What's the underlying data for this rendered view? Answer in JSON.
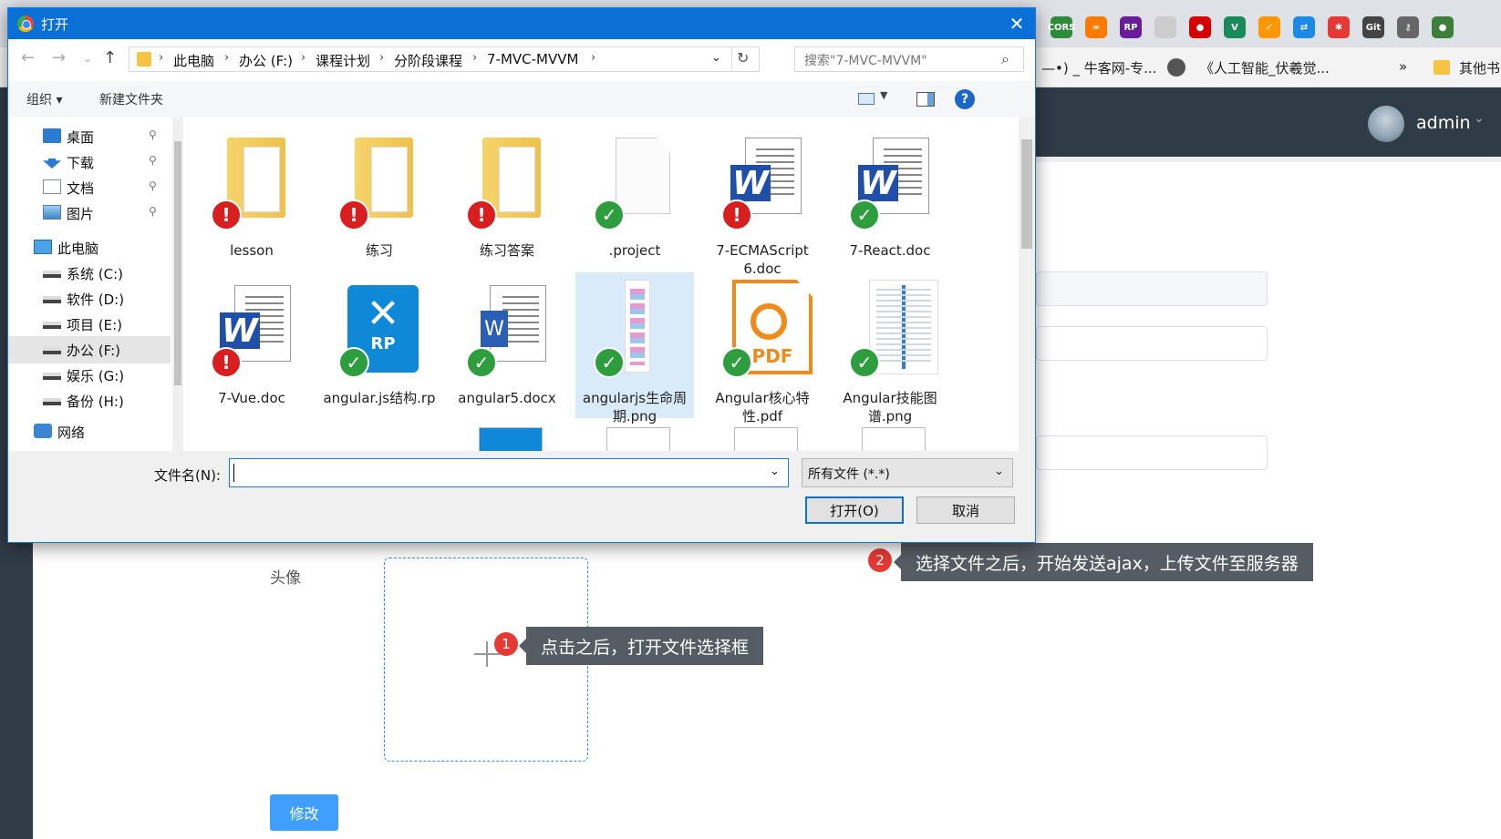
{
  "dialog": {
    "title": "打开",
    "breadcrumb": [
      "此电脑",
      "办公 (F:)",
      "课程计划",
      "分阶段课程",
      "7-MVC-MVVM"
    ],
    "search_placeholder": "搜索\"7-MVC-MVVM\"",
    "toolbar": {
      "organize": "组织 ▾",
      "new_folder": "新建文件夹"
    },
    "nav_items": [
      {
        "label": "桌面",
        "icon": "desktop-icon",
        "pinned": true
      },
      {
        "label": "下载",
        "icon": "download-icon",
        "pinned": true
      },
      {
        "label": "文档",
        "icon": "documents-icon",
        "pinned": true
      },
      {
        "label": "图片",
        "icon": "pictures-icon",
        "pinned": true
      },
      {
        "label": "此电脑",
        "icon": "computer-icon",
        "pinned": false
      },
      {
        "label": "系统 (C:)",
        "icon": "drive-icon",
        "pinned": false
      },
      {
        "label": "软件 (D:)",
        "icon": "drive-icon",
        "pinned": false
      },
      {
        "label": "项目 (E:)",
        "icon": "drive-icon",
        "pinned": false
      },
      {
        "label": "办公 (F:)",
        "icon": "drive-icon",
        "pinned": false,
        "selected": true
      },
      {
        "label": "娱乐 (G:)",
        "icon": "drive-icon",
        "pinned": false
      },
      {
        "label": "备份 (H:)",
        "icon": "drive-icon",
        "pinned": false
      },
      {
        "label": "网络",
        "icon": "network-icon",
        "pinned": false
      }
    ],
    "files": [
      {
        "name": "lesson",
        "type": "folder",
        "status": "error"
      },
      {
        "name": "练习",
        "type": "folder",
        "status": "error"
      },
      {
        "name": "练习答案",
        "type": "folder",
        "status": "error"
      },
      {
        "name": ".project",
        "type": "blank",
        "status": "ok"
      },
      {
        "name": "7-ECMAScript 6.doc",
        "type": "word",
        "status": "error"
      },
      {
        "name": "7-React.doc",
        "type": "word",
        "status": "ok"
      },
      {
        "name": "7-Vue.doc",
        "type": "word",
        "status": "error"
      },
      {
        "name": "angular.js结构.rp",
        "type": "axure",
        "status": "ok"
      },
      {
        "name": "angular5.docx",
        "type": "docx",
        "status": "ok"
      },
      {
        "name": "angularjs生命周期.png",
        "type": "image",
        "status": "ok",
        "selected": true
      },
      {
        "name": "Angular核心特性.pdf",
        "type": "pdf",
        "status": "ok"
      },
      {
        "name": "Angular技能图谱.png",
        "type": "image2",
        "status": "ok"
      }
    ],
    "filename_label": "文件名(N):",
    "filename_value": "",
    "filetype_value": "所有文件 (*.*)",
    "open_label": "打开(O)",
    "cancel_label": "取消"
  },
  "browser": {
    "bookmarks": [
      "—•) _ 牛客网-专...",
      "《人工智能_伏羲觉...",
      "»",
      "其他书"
    ],
    "extensions": [
      {
        "label": "CORS",
        "color": "#2e8b3a"
      },
      {
        "label": "∞",
        "color": "#ff7a00"
      },
      {
        "label": "RP",
        "color": "#6a1b9a"
      },
      {
        "label": "",
        "color": "#cccccc"
      },
      {
        "label": "●",
        "color": "#d50000"
      },
      {
        "label": "V",
        "color": "#1b8a5a"
      },
      {
        "label": "✓",
        "color": "#ff9800"
      },
      {
        "label": "⇄",
        "color": "#1e88e5"
      },
      {
        "label": "✱",
        "color": "#e53935"
      },
      {
        "label": "Git",
        "color": "#444444"
      },
      {
        "label": "⚷",
        "color": "#666666"
      },
      {
        "label": "●",
        "color": "#3d7f3a"
      }
    ]
  },
  "app": {
    "user_name": "admin",
    "avatar_label": "头像",
    "modify_button": "修改"
  },
  "callouts": {
    "one_number": "1",
    "one_text": "点击之后，打开文件选择框",
    "two_number": "2",
    "two_text": "选择文件之后，开始发送ajax，上传文件至服务器"
  }
}
